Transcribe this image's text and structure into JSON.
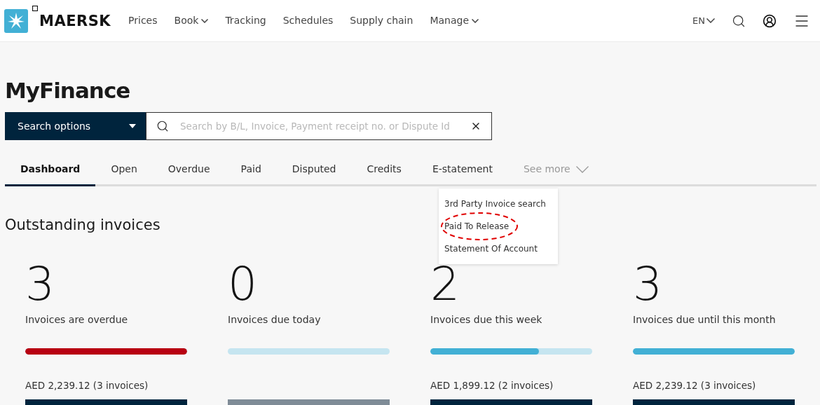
{
  "header": {
    "logo": "MAERSK",
    "nav": [
      {
        "label": "Prices",
        "dropdown": false
      },
      {
        "label": "Book",
        "dropdown": true
      },
      {
        "label": "Tracking",
        "dropdown": false
      },
      {
        "label": "Schedules",
        "dropdown": false
      },
      {
        "label": "Supply chain",
        "dropdown": false
      },
      {
        "label": "Manage",
        "dropdown": true
      }
    ],
    "language": "EN"
  },
  "title": "MyFinance",
  "search": {
    "options_label": "Search options",
    "placeholder": "Search by B/L, Invoice, Payment receipt no. or Dispute Id"
  },
  "tabs": [
    {
      "label": "Dashboard",
      "selected": true
    },
    {
      "label": "Open",
      "selected": false
    },
    {
      "label": "Overdue",
      "selected": false
    },
    {
      "label": "Paid",
      "selected": false
    },
    {
      "label": "Disputed",
      "selected": false
    },
    {
      "label": "Credits",
      "selected": false
    },
    {
      "label": "E-statement",
      "selected": false
    }
  ],
  "see_more": {
    "label": "See more",
    "expanded": true,
    "items": [
      {
        "label": "3rd Party Invoice search",
        "circled": false
      },
      {
        "label": "Paid To Release",
        "circled": true
      },
      {
        "label": "Statement Of Account",
        "circled": false
      }
    ]
  },
  "section_title": "Outstanding invoices",
  "cards": [
    {
      "count": "3",
      "label": "Invoices are overdue",
      "level": 1,
      "color": "#b80012",
      "amount": "AED 2,239.12 (3 invoices)",
      "disabled": false
    },
    {
      "count": "0",
      "label": "Invoices due today",
      "disabled": true
    },
    {
      "count": "2",
      "label": "Invoices due this week",
      "level": 0.67,
      "color": "#42b0d5",
      "amount": "AED 1,899.12 (2 invoices)",
      "disabled": false
    },
    {
      "count": "3",
      "label": "Invoices due until this month",
      "level": 1,
      "color": "#42b0d5",
      "amount": "AED 2,239.12 (3 invoices)",
      "disabled": false
    }
  ]
}
